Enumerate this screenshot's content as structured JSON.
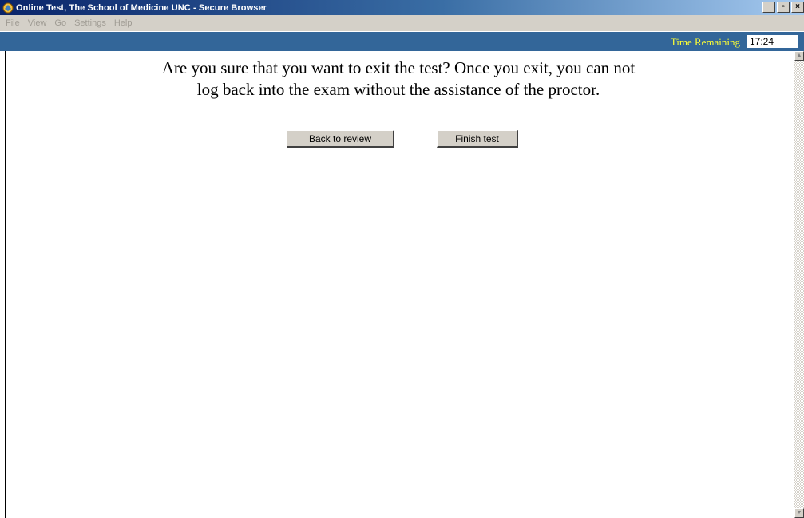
{
  "window": {
    "title": "Online Test, The School of Medicine UNC - Secure Browser",
    "controls": {
      "minimize": "_",
      "maximize": "▫",
      "close": "×"
    },
    "icon": "app-icon"
  },
  "menu": {
    "items": [
      "File",
      "View",
      "Go",
      "Settings",
      "Help"
    ],
    "enabled": false
  },
  "header": {
    "time_label": "Time Remaining",
    "time_value": "17:24",
    "label_color": "#ffff33",
    "bar_color": "#336699"
  },
  "dialog": {
    "line1": "Are you sure that you want to exit the test? Once you exit, you can not",
    "line2": "log back into the exam without the assistance of the proctor.",
    "back_label": "Back to review",
    "finish_label": "Finish test"
  },
  "scrollbar": {
    "up_icon": "▲",
    "down_icon": "▼"
  }
}
